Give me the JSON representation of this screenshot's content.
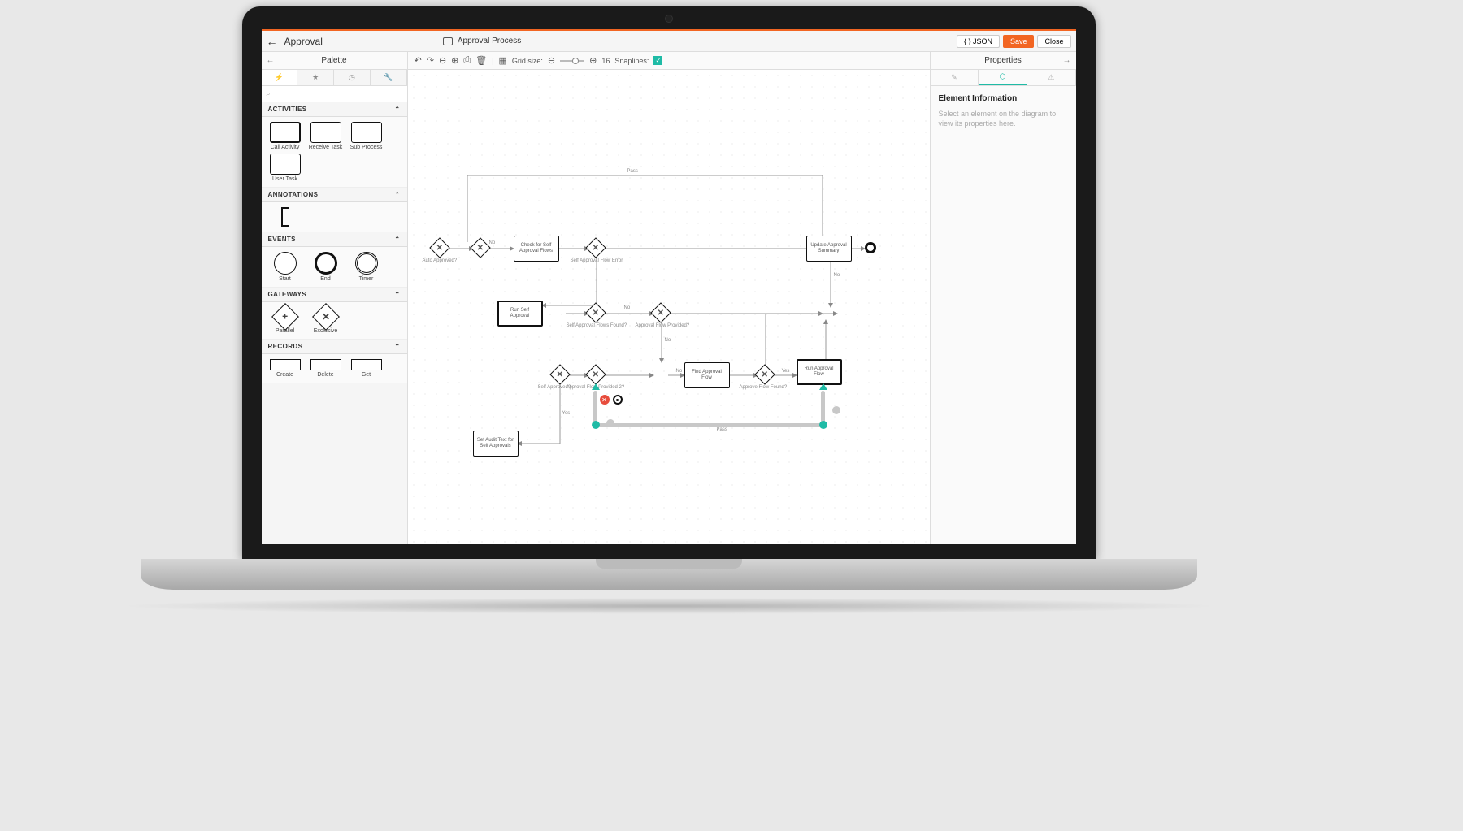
{
  "header": {
    "back_title": "Approval",
    "process_title": "Approval Process",
    "json_btn": "{ } JSON",
    "save_btn": "Save",
    "close_btn": "Close"
  },
  "palette": {
    "title": "Palette",
    "search_placeholder": "",
    "sections": {
      "activities": {
        "title": "ACTIVITIES",
        "items": [
          "Call Activity",
          "Receive Task",
          "Sub Process",
          "User Task"
        ]
      },
      "annotations": {
        "title": "ANNOTATIONS"
      },
      "events": {
        "title": "EVENTS",
        "items": [
          "Start",
          "End",
          "Timer"
        ]
      },
      "gateways": {
        "title": "GATEWAYS",
        "items": [
          "Parallel",
          "Exclusive"
        ]
      },
      "records": {
        "title": "RECORDS",
        "items": [
          "Create",
          "Delete",
          "Get"
        ]
      }
    }
  },
  "toolbar": {
    "grid_size_label": "Grid size:",
    "grid_value": "16",
    "snaplines_label": "Snaplines:"
  },
  "properties": {
    "title": "Properties",
    "heading": "Element Information",
    "help": "Select an element on the diagram to view its properties here."
  },
  "diagram": {
    "labels": {
      "auto_approved": "Auto Approved?",
      "check_self": "Check for Self Approval Flows",
      "self_error": "Self Approval Flow Error",
      "update_summary": "Update Approval Summary",
      "run_self": "Run Self Approval",
      "self_flows_found": "Self Approval Flows Found?",
      "flow_provided": "Approval Flow Provided?",
      "self_approved": "Self Approved?",
      "flow_provided_2": "Approval Flow Provided 2?",
      "find_flow": "Find Approval Flow",
      "approve_found": "Approve Flow Found?",
      "run_approval": "Run Approval Flow",
      "set_audit": "Set Audit Text for Self Approvals",
      "yes": "Yes",
      "no": "No",
      "pass": "Pass"
    }
  }
}
